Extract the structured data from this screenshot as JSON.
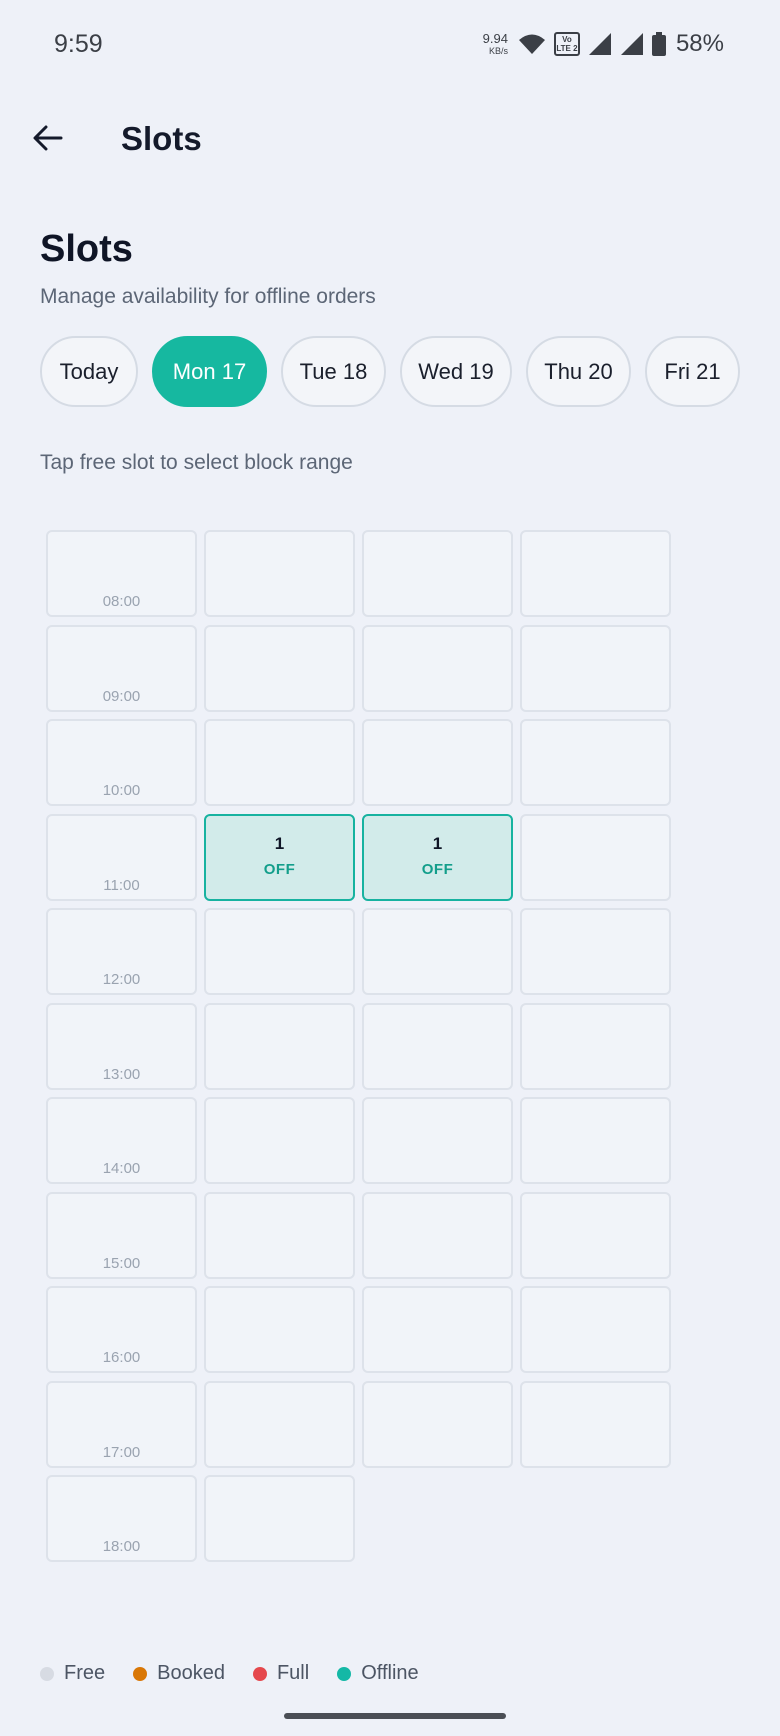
{
  "status_bar": {
    "time": "9:59",
    "net_speed": "9.94",
    "net_unit": "KB/s",
    "volte": [
      "Vo",
      "LTE 2"
    ],
    "battery": "58%"
  },
  "app_bar": {
    "title": "Slots"
  },
  "header": {
    "title": "Slots",
    "subtitle": "Manage availability for offline orders"
  },
  "days": [
    {
      "label": "Today",
      "active": false
    },
    {
      "label": "Mon 17",
      "active": true
    },
    {
      "label": "Tue 18",
      "active": false
    },
    {
      "label": "Wed 19",
      "active": false
    },
    {
      "label": "Thu 20",
      "active": false
    },
    {
      "label": "Fri 21",
      "active": false
    }
  ],
  "hint": "Tap free slot to select block range",
  "slots": [
    {
      "time": "08:00",
      "status": "free"
    },
    {
      "status": "free"
    },
    {
      "status": "free"
    },
    {
      "status": "free"
    },
    {
      "time": "09:00",
      "status": "free"
    },
    {
      "status": "free"
    },
    {
      "status": "free"
    },
    {
      "status": "free"
    },
    {
      "time": "10:00",
      "status": "free"
    },
    {
      "status": "free"
    },
    {
      "status": "free"
    },
    {
      "status": "free"
    },
    {
      "time": "11:00",
      "status": "free"
    },
    {
      "status": "offline",
      "count": "1",
      "tag": "OFF"
    },
    {
      "status": "offline",
      "count": "1",
      "tag": "OFF"
    },
    {
      "status": "free"
    },
    {
      "time": "12:00",
      "status": "free"
    },
    {
      "status": "free"
    },
    {
      "status": "free"
    },
    {
      "status": "free"
    },
    {
      "time": "13:00",
      "status": "free"
    },
    {
      "status": "free"
    },
    {
      "status": "free"
    },
    {
      "status": "free"
    },
    {
      "time": "14:00",
      "status": "free"
    },
    {
      "status": "free"
    },
    {
      "status": "free"
    },
    {
      "status": "free"
    },
    {
      "time": "15:00",
      "status": "free"
    },
    {
      "status": "free"
    },
    {
      "status": "free"
    },
    {
      "status": "free"
    },
    {
      "time": "16:00",
      "status": "free"
    },
    {
      "status": "free"
    },
    {
      "status": "free"
    },
    {
      "status": "free"
    },
    {
      "time": "17:00",
      "status": "free"
    },
    {
      "status": "free"
    },
    {
      "status": "free"
    },
    {
      "status": "free"
    },
    {
      "time": "18:00",
      "status": "free"
    },
    {
      "status": "free"
    }
  ],
  "legend": [
    {
      "label": "Free",
      "color": "#d7dbe3"
    },
    {
      "label": "Booked",
      "color": "#d97706"
    },
    {
      "label": "Full",
      "color": "#e5484d"
    },
    {
      "label": "Offline",
      "color": "#14b8a6"
    }
  ]
}
